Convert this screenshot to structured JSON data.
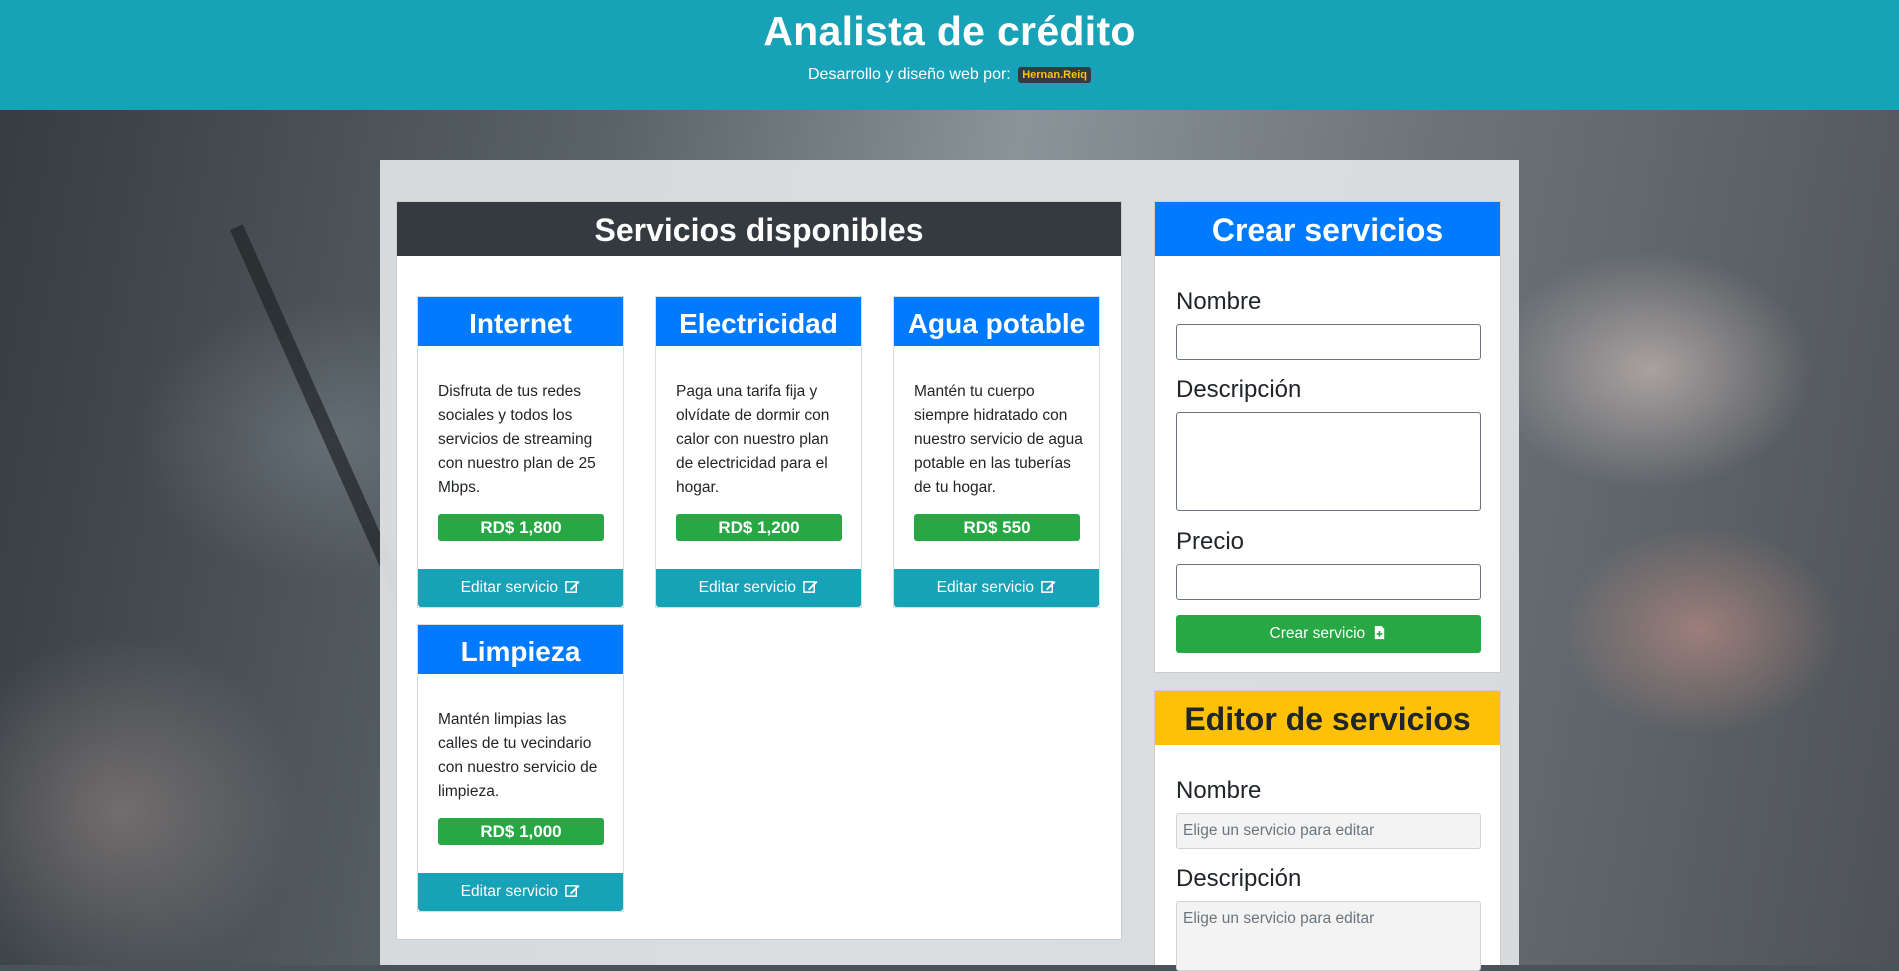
{
  "header": {
    "title": "Analista de crédito",
    "credit_text": "Desarrollo y diseño web por:",
    "credit_badge": "Hernan.Reiq"
  },
  "services_panel": {
    "title": "Servicios disponibles",
    "edit_label": "Editar servicio",
    "services": [
      {
        "name": "Internet",
        "description": "Disfruta de tus redes sociales y todos los servicios de streaming con nuestro plan de 25 Mbps.",
        "price": "RD$ 1,800"
      },
      {
        "name": "Electricidad",
        "description": "Paga una tarifa fija y olvídate de dormir con calor con nuestro plan de electricidad para el hogar.",
        "price": "RD$ 1,200"
      },
      {
        "name": "Agua potable",
        "description": "Mantén tu cuerpo siempre hidratado con nuestro servicio de agua potable en las tuberías de tu hogar.",
        "price": "RD$ 550"
      },
      {
        "name": "Limpieza",
        "description": "Mantén limpias las calles de tu vecindario con nuestro servicio de limpieza.",
        "price": "RD$ 1,000"
      }
    ]
  },
  "create_form": {
    "title": "Crear servicios",
    "name_label": "Nombre",
    "description_label": "Descripción",
    "price_label": "Precio",
    "submit_label": "Crear servicio"
  },
  "editor_form": {
    "title": "Editor de servicios",
    "name_label": "Nombre",
    "name_placeholder": "Elige un servicio para editar",
    "description_label": "Descripción",
    "description_placeholder": "Elige un servicio para editar"
  },
  "colors": {
    "header": "#17a2b8",
    "primary": "#007bff",
    "success": "#28a745",
    "warning": "#ffc107",
    "dark": "#343a40"
  },
  "icons": {
    "edit": "edit-icon",
    "create": "file-plus-icon"
  }
}
